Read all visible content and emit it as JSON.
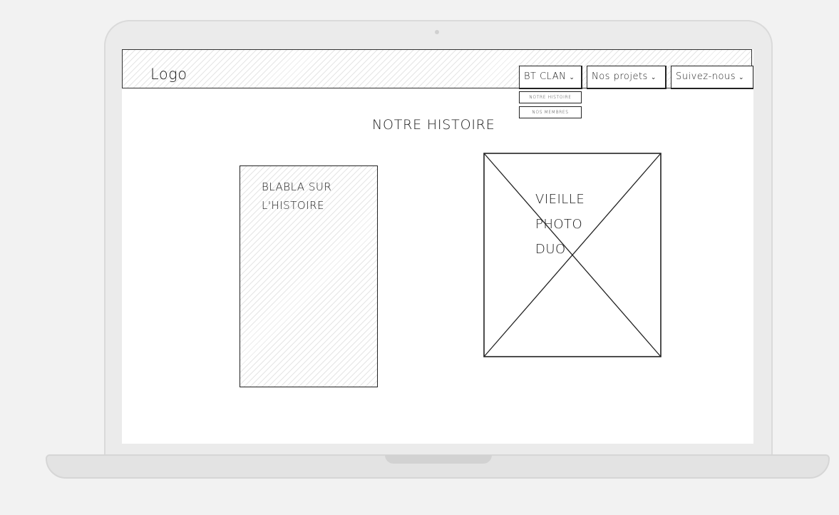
{
  "navbar": {
    "logo": "Logo",
    "menu": [
      {
        "label": "BT CLAN",
        "chevron": "⌄"
      },
      {
        "label": "Nos projets",
        "chevron": "⌄"
      },
      {
        "label": "Suivez-nous",
        "chevron": "⌄"
      }
    ],
    "dropdown": [
      "NOTRE HISTOIRE",
      "NOS MEMBRES"
    ]
  },
  "page": {
    "heading": "NOTRE HISTOIRE",
    "text_block": "BLABLA SUR L'HISTOIRE",
    "image_label_lines": [
      "VIEILLE",
      "PHOTO",
      "DUO"
    ]
  },
  "icons": {
    "chevron": "chevron-down-icon",
    "image": "image-placeholder-cross-icon"
  }
}
